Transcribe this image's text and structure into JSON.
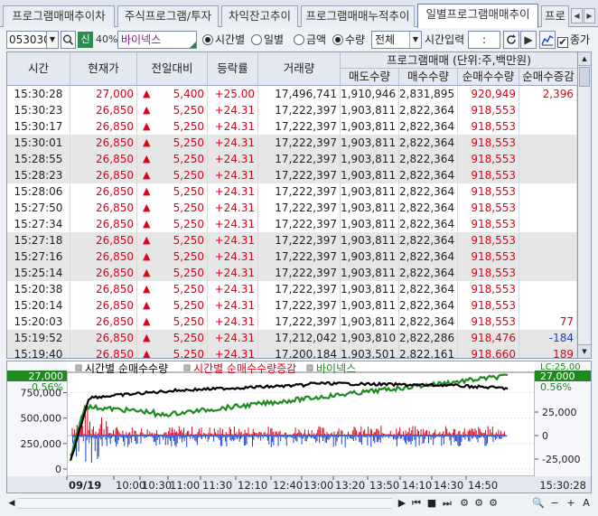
{
  "tabs": [
    "프로그램매매추이차",
    "주식프로그램/투자",
    "차익잔고추이",
    "프로그램매매누적추이",
    "일별프로그램매매추이",
    "프로"
  ],
  "active_tab": 4,
  "toolbar": {
    "stock_code": "053030",
    "credit_badge": "신",
    "margin_rate": "40%",
    "stock_name": "바이넥스",
    "radio_time": "시간별",
    "radio_day": "일별",
    "radio_amount": "금액",
    "radio_qty": "수량",
    "select_value": "전체",
    "time_label": "시간입력",
    "time_input": ":",
    "close_price_label": "종가"
  },
  "grid": {
    "headers": {
      "time": "시간",
      "price": "현재가",
      "change": "전일대비",
      "rate": "등락률",
      "volume": "거래량",
      "program_group": "프로그램매매 (단위:주,백만원)",
      "sell_qty": "매도수량",
      "buy_qty": "매수수량",
      "net_qty": "순매수수량",
      "net_change": "순매수증감"
    },
    "rows": [
      {
        "time": "15:30:28",
        "price": "27,000",
        "change": "5,400",
        "rate": "+25.00",
        "volume": "17,496,741",
        "sell": "1,910,946",
        "buy": "2,831,895",
        "net": "920,949",
        "delta": "2,396",
        "delta_color": "red",
        "gray": false
      },
      {
        "time": "15:30:23",
        "price": "26,850",
        "change": "5,250",
        "rate": "+24.31",
        "volume": "17,222,397",
        "sell": "1,903,811",
        "buy": "2,822,364",
        "net": "918,553",
        "delta": "",
        "delta_color": "red",
        "gray": false
      },
      {
        "time": "15:30:17",
        "price": "26,850",
        "change": "5,250",
        "rate": "+24.31",
        "volume": "17,222,397",
        "sell": "1,903,811",
        "buy": "2,822,364",
        "net": "918,553",
        "delta": "",
        "delta_color": "red",
        "gray": false
      },
      {
        "time": "15:30:01",
        "price": "26,850",
        "change": "5,250",
        "rate": "+24.31",
        "volume": "17,222,397",
        "sell": "1,903,811",
        "buy": "2,822,364",
        "net": "918,553",
        "delta": "",
        "delta_color": "red",
        "gray": true
      },
      {
        "time": "15:28:55",
        "price": "26,850",
        "change": "5,250",
        "rate": "+24.31",
        "volume": "17,222,397",
        "sell": "1,903,811",
        "buy": "2,822,364",
        "net": "918,553",
        "delta": "",
        "delta_color": "red",
        "gray": true
      },
      {
        "time": "15:28:23",
        "price": "26,850",
        "change": "5,250",
        "rate": "+24.31",
        "volume": "17,222,397",
        "sell": "1,903,811",
        "buy": "2,822,364",
        "net": "918,553",
        "delta": "",
        "delta_color": "red",
        "gray": true
      },
      {
        "time": "15:28:06",
        "price": "26,850",
        "change": "5,250",
        "rate": "+24.31",
        "volume": "17,222,397",
        "sell": "1,903,811",
        "buy": "2,822,364",
        "net": "918,553",
        "delta": "",
        "delta_color": "red",
        "gray": false
      },
      {
        "time": "15:27:50",
        "price": "26,850",
        "change": "5,250",
        "rate": "+24.31",
        "volume": "17,222,397",
        "sell": "1,903,811",
        "buy": "2,822,364",
        "net": "918,553",
        "delta": "",
        "delta_color": "red",
        "gray": false
      },
      {
        "time": "15:27:34",
        "price": "26,850",
        "change": "5,250",
        "rate": "+24.31",
        "volume": "17,222,397",
        "sell": "1,903,811",
        "buy": "2,822,364",
        "net": "918,553",
        "delta": "",
        "delta_color": "red",
        "gray": false
      },
      {
        "time": "15:27:18",
        "price": "26,850",
        "change": "5,250",
        "rate": "+24.31",
        "volume": "17,222,397",
        "sell": "1,903,811",
        "buy": "2,822,364",
        "net": "918,553",
        "delta": "",
        "delta_color": "red",
        "gray": true
      },
      {
        "time": "15:27:16",
        "price": "26,850",
        "change": "5,250",
        "rate": "+24.31",
        "volume": "17,222,397",
        "sell": "1,903,811",
        "buy": "2,822,364",
        "net": "918,553",
        "delta": "",
        "delta_color": "red",
        "gray": true
      },
      {
        "time": "15:25:14",
        "price": "26,850",
        "change": "5,250",
        "rate": "+24.31",
        "volume": "17,222,397",
        "sell": "1,903,811",
        "buy": "2,822,364",
        "net": "918,553",
        "delta": "",
        "delta_color": "red",
        "gray": true
      },
      {
        "time": "15:20:38",
        "price": "26,850",
        "change": "5,250",
        "rate": "+24.31",
        "volume": "17,222,397",
        "sell": "1,903,811",
        "buy": "2,822,364",
        "net": "918,553",
        "delta": "",
        "delta_color": "red",
        "gray": false
      },
      {
        "time": "15:20:14",
        "price": "26,850",
        "change": "5,250",
        "rate": "+24.31",
        "volume": "17,222,397",
        "sell": "1,903,811",
        "buy": "2,822,364",
        "net": "918,553",
        "delta": "",
        "delta_color": "red",
        "gray": false
      },
      {
        "time": "15:20:03",
        "price": "26,850",
        "change": "5,250",
        "rate": "+24.31",
        "volume": "17,222,397",
        "sell": "1,903,811",
        "buy": "2,822,364",
        "net": "918,553",
        "delta": "77",
        "delta_color": "red",
        "gray": false
      },
      {
        "time": "15:19:52",
        "price": "26,850",
        "change": "5,250",
        "rate": "+24.31",
        "volume": "17,212,042",
        "sell": "1,903,810",
        "buy": "2,822,286",
        "net": "918,476",
        "delta": "-184",
        "delta_color": "blue",
        "gray": true
      },
      {
        "time": "15:19:40",
        "price": "26,850",
        "change": "5,250",
        "rate": "+24.31",
        "volume": "17,200,184",
        "sell": "1,903,501",
        "buy": "2,822,161",
        "net": "918,660",
        "delta": "189",
        "delta_color": "red",
        "gray": true
      }
    ]
  },
  "chart_data": {
    "type": "line",
    "legend": [
      "시간별 순매수수량",
      "시간별 순매수수량증감",
      "바이넥스"
    ],
    "legend_colors": [
      "#000000",
      "#e0001a",
      "#1f8a1f"
    ],
    "left_axis_ticks": [
      "750,000",
      "500,000",
      "250,000",
      "0"
    ],
    "left_axis_values": [
      750000,
      500000,
      250000,
      0
    ],
    "left_top_labels": [
      "27,000",
      "0.56%"
    ],
    "right_axis_ticks": [
      "25,000",
      "0",
      "-25,000"
    ],
    "right_top_labels": [
      "LC:25,00",
      "27,000",
      "0.56%"
    ],
    "x_ticks": [
      "09/19",
      "10:00",
      "10:30",
      "11:00",
      "11:30",
      "12:10",
      "12:40",
      "13:00",
      "13:20",
      "13:50",
      "14:10",
      "14:30",
      "14:50"
    ],
    "last_time": "15:30:28",
    "net_buy_qty_start": 0,
    "net_buy_qty_end": 920949
  },
  "bottom_toolbar": {
    "buttons": [
      "▶",
      "⏮",
      "■",
      "⏭",
      "⚙",
      "⚙",
      "⚙",
      "🔍",
      "−",
      "+",
      "A"
    ]
  }
}
